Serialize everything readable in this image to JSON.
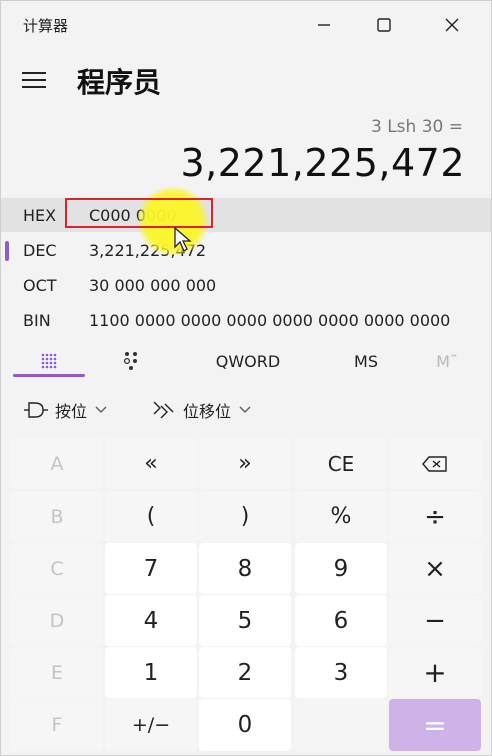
{
  "window": {
    "title": "计算器"
  },
  "header": {
    "mode": "程序员"
  },
  "display": {
    "expression": "3 Lsh 30 =",
    "result": "3,221,225,472"
  },
  "radix": [
    {
      "label": "HEX",
      "value": "C000 0000"
    },
    {
      "label": "DEC",
      "value": "3,221,225,472"
    },
    {
      "label": "OCT",
      "value": "30 000 000 000"
    },
    {
      "label": "BIN",
      "value": "1100 0000 0000 0000 0000 0000 0000 0000"
    }
  ],
  "tabs": {
    "word_size": "QWORD",
    "memory_store": "MS",
    "memory_menu": "M˜"
  },
  "bitwise": {
    "bitwise_label": "按位",
    "bitshift_label": "位移位"
  },
  "keys": {
    "A": "A",
    "lsh": "«",
    "rsh": "»",
    "ce": "CE",
    "B": "B",
    "lparen": "(",
    "rparen": ")",
    "mod": "%",
    "divide": "÷",
    "C": "C",
    "k7": "7",
    "k8": "8",
    "k9": "9",
    "multiply": "×",
    "D": "D",
    "k4": "4",
    "k5": "5",
    "k6": "6",
    "minus": "−",
    "E": "E",
    "k1": "1",
    "k2": "2",
    "k3": "3",
    "plus": "+",
    "F": "F",
    "negate": "+/−",
    "k0": "0",
    "equals": "="
  },
  "icons": [
    "hamburger-icon",
    "backspace-icon",
    "keypad-icon",
    "bit-toggle-icon",
    "bitwise-gate-icon",
    "bitshift-icon",
    "minimize-icon",
    "maximize-icon",
    "close-icon"
  ],
  "colors": {
    "accent": "#8e5bc8",
    "equals_bg": "#cdb3e8",
    "highlight_box": "#d9232d"
  }
}
